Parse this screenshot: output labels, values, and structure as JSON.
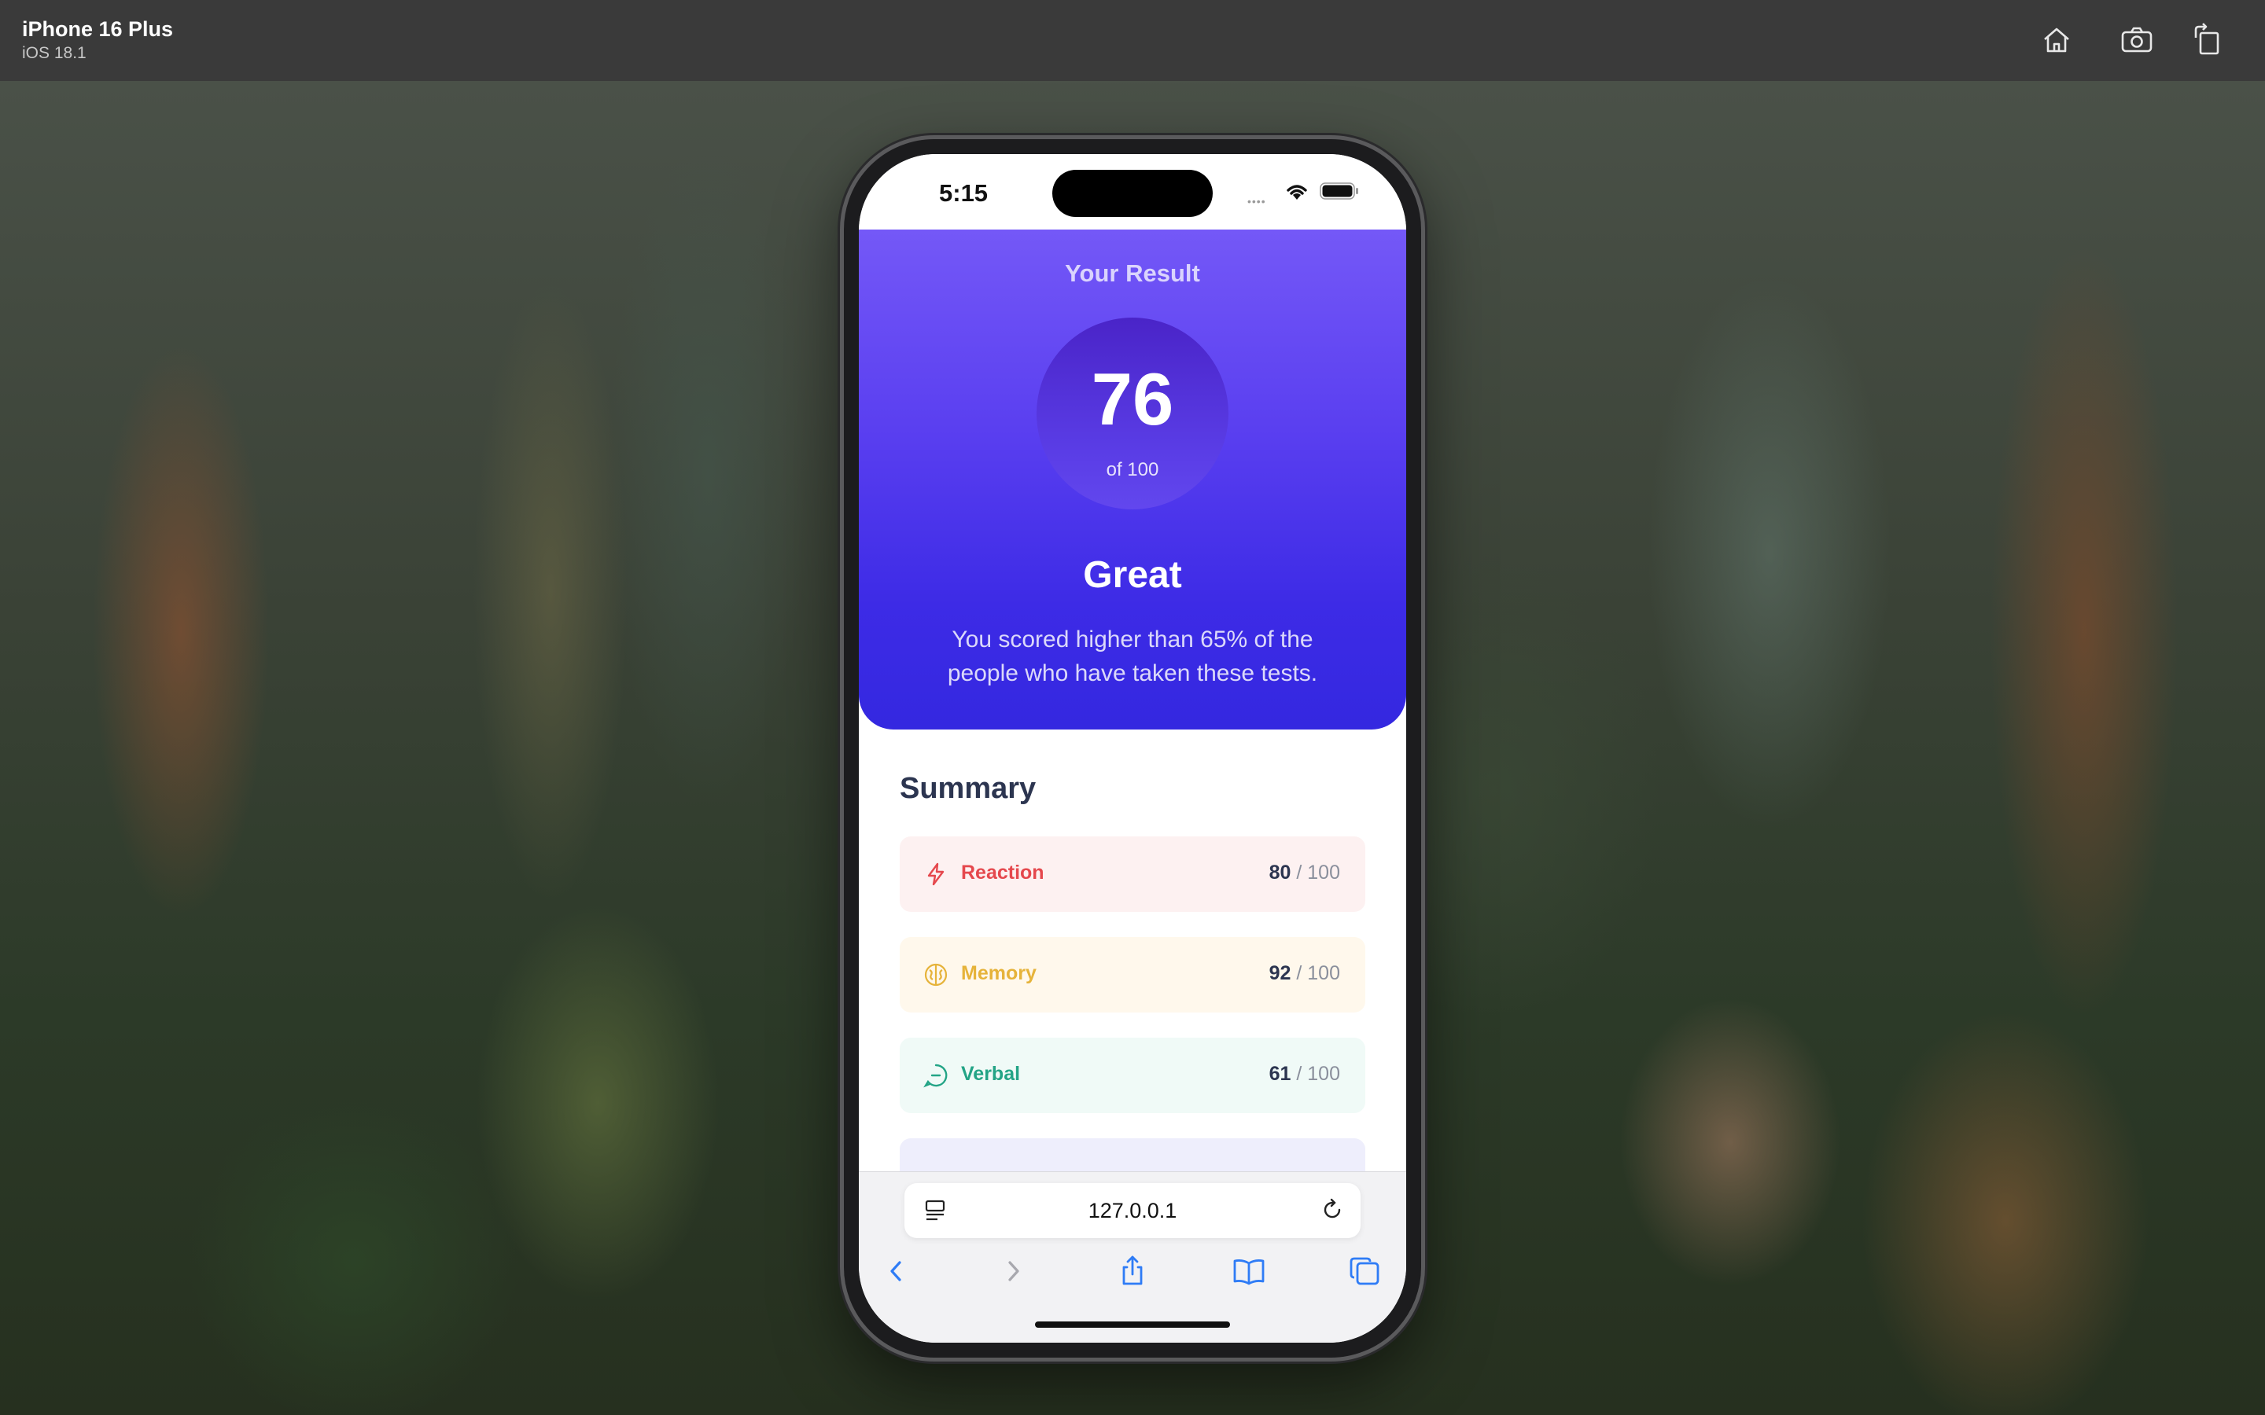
{
  "simulator": {
    "device_name": "iPhone 16 Plus",
    "os_version": "iOS 18.1",
    "icons": [
      "home-icon",
      "screenshot-icon",
      "rotate-icon"
    ]
  },
  "status_bar": {
    "time": "5:15",
    "icons": [
      "wifi-icon",
      "battery-icon"
    ]
  },
  "result": {
    "heading": "Your Result",
    "score": "76",
    "score_max": "of 100",
    "rating": "Great",
    "description": "You scored higher than 65% of the people who have taken these tests."
  },
  "summary": {
    "title": "Summary",
    "items": [
      {
        "label": "Reaction",
        "score": "80",
        "max": "/ 100",
        "icon": "lightning-icon",
        "color": "#e5484d",
        "bg": "#fdf1f1"
      },
      {
        "label": "Memory",
        "score": "92",
        "max": "/ 100",
        "icon": "brain-icon",
        "color": "#e6b33a",
        "bg": "#fff8ec"
      },
      {
        "label": "Verbal",
        "score": "61",
        "max": "/ 100",
        "icon": "chat-icon",
        "color": "#23a486",
        "bg": "#f0faf7"
      },
      {
        "label": "",
        "score": "",
        "max": "",
        "icon": "eye-icon",
        "color": "#5a4de6",
        "bg": "#eeeefc"
      }
    ]
  },
  "browser": {
    "url": "127.0.0.1",
    "icons": [
      "reader-icon",
      "reload-icon",
      "back-icon",
      "forward-icon",
      "share-icon",
      "bookmarks-icon",
      "tabs-icon"
    ]
  },
  "colors": {
    "accent": "#4b32ea",
    "text_dark": "#2c3550"
  }
}
